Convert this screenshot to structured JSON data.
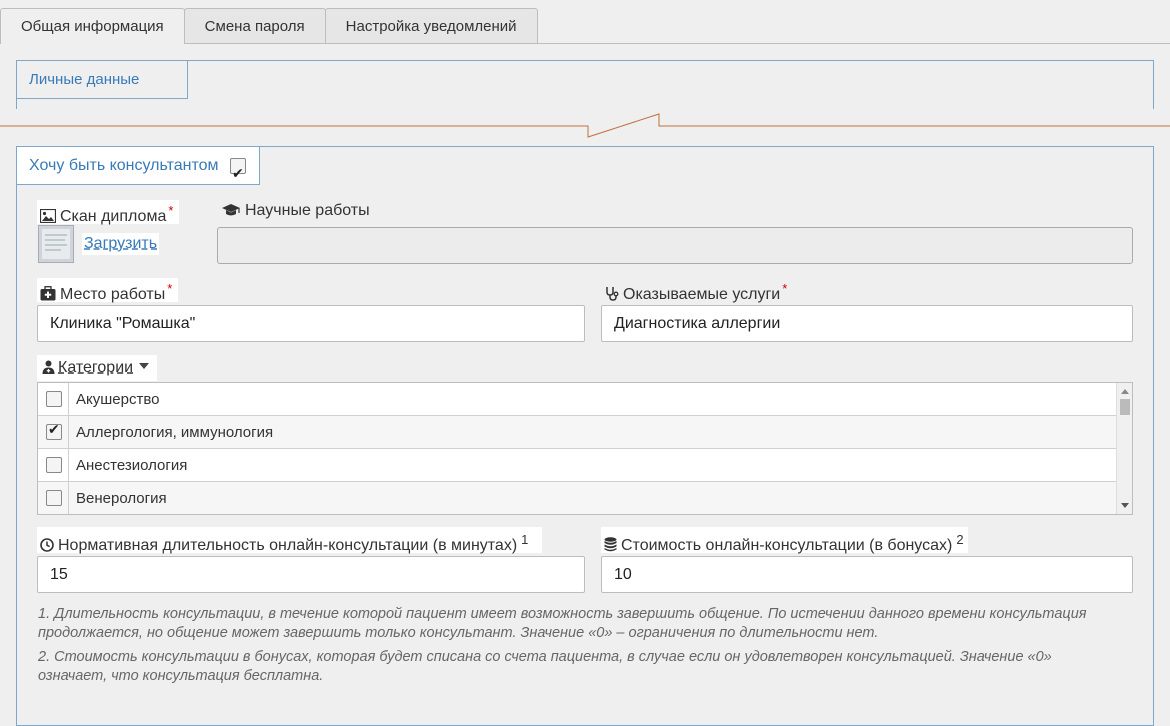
{
  "tabs": [
    {
      "label": "Общая информация",
      "active": true
    },
    {
      "label": "Смена пароля",
      "active": false
    },
    {
      "label": "Настройка уведомлений",
      "active": false
    }
  ],
  "personal_legend": "Личные данные",
  "consultant": {
    "legend": "Хочу быть консультантом",
    "checked": true
  },
  "diploma": {
    "label": "Скан диплома",
    "required": "*",
    "upload_label": "Загрузить"
  },
  "science": {
    "label": "Научные работы",
    "value": ""
  },
  "workplace": {
    "label": "Место работы",
    "required": "*",
    "value": "Клиника \"Ромашка\""
  },
  "services": {
    "label": "Оказываемые услуги",
    "required": "*",
    "value": "Диагностика аллергии"
  },
  "categories": {
    "label": "Категории",
    "items": [
      {
        "name": "Акушерство",
        "checked": false
      },
      {
        "name": "Аллергология, иммунология",
        "checked": true
      },
      {
        "name": "Анестезиология",
        "checked": false
      },
      {
        "name": "Венерология",
        "checked": false
      }
    ]
  },
  "duration": {
    "label": "Нормативная длительность онлайн-консультации (в минутах)",
    "footnote": "1",
    "value": "15"
  },
  "cost": {
    "label": "Стоимость онлайн-консультации (в бонусах)",
    "footnote": "2",
    "value": "10"
  },
  "notes": [
    "1. Длительность консультации, в течение которой пациент имеет возможность завершить общение. По истечении данного времени консультация продолжается, но общение может завершить только консультант. Значение «0» – ограничения по длительности нет.",
    "2. Стоимость консультации в бонусах, которая будет списана со счета пациента, в случае если он удовлетворен консультацией. Значение «0» означает, что консультация бесплатна."
  ],
  "icons": {
    "diploma": "image-icon",
    "science": "graduation-cap-icon",
    "workplace": "medkit-icon",
    "services": "stethoscope-icon",
    "categories": "user-md-icon",
    "duration": "clock-icon",
    "cost": "database-icon"
  },
  "colors": {
    "accent": "#3a7ab8",
    "border": "#7fa7c9",
    "required": "#cc0000"
  }
}
